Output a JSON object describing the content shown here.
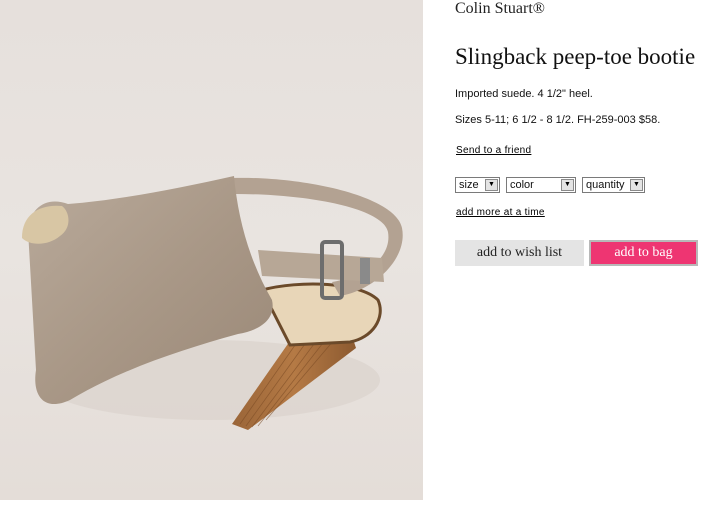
{
  "product": {
    "brand": "Colin Stuart®",
    "title": "Slingback peep-toe bootie",
    "description": "Imported suede. 4 1/2\" heel.",
    "sizes_info": "Sizes 5-11; 6 1/2 - 8 1/2. FH-259-003 $58.",
    "image_alt": "Slingback peep-toe bootie suede with stacked heel"
  },
  "links": {
    "send_to_friend": "Send to a friend",
    "add_more": "add more at a time"
  },
  "selects": {
    "size": "size",
    "color": "color",
    "quantity": "quantity"
  },
  "buttons": {
    "wish_list": "add to wish list",
    "bag": "add to bag"
  },
  "colors": {
    "bag_button": "#ee3572",
    "wish_button": "#e4e4e4"
  }
}
